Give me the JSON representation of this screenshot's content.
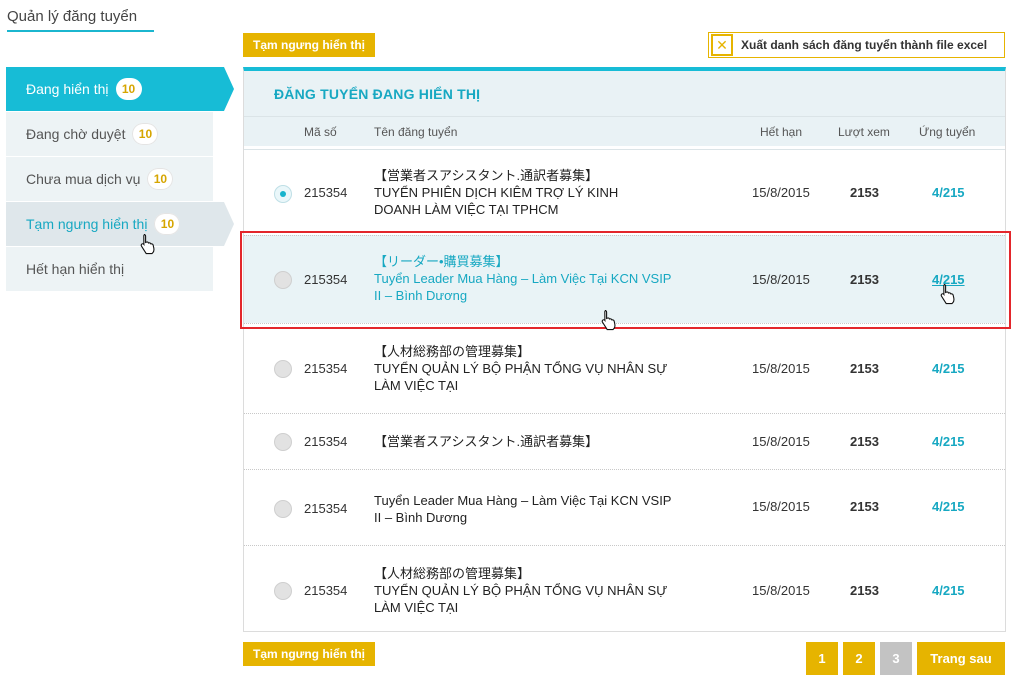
{
  "page": {
    "title": "Quản lý đăng tuyển"
  },
  "sidebar": {
    "items": [
      {
        "label": "Đang hiển thị",
        "count": "10"
      },
      {
        "label": "Đang chờ duyệt",
        "count": "10"
      },
      {
        "label": "Chưa mua dịch vụ",
        "count": "10"
      },
      {
        "label": "Tạm ngưng hiển thị",
        "count": "10"
      },
      {
        "label": "Hết hạn hiển thị"
      }
    ]
  },
  "toolbar": {
    "suspend_label": "Tạm ngưng hiển thị",
    "export_label": "Xuất danh sách đăng tuyển thành file excel",
    "export_icon": "excel-icon"
  },
  "panel": {
    "heading": "ĐĂNG TUYỂN ĐANG HIỂN THỊ",
    "columns": {
      "id": "Mã số",
      "title": "Tên đăng tuyển",
      "expiry": "Hết hạn",
      "views": "Lượt xem",
      "applied": "Ứng tuyển"
    },
    "rows": [
      {
        "id": "215354",
        "title_lines": [
          "【営業者スアシスタント.通訳者募集】",
          "TUYỂN PHIÊN DỊCH KIÊM TRỢ LÝ KINH",
          "DOANH LÀM VIỆC TẠI TPHCM"
        ],
        "expiry": "15/8/2015",
        "views": "2153",
        "applied": "4/215"
      },
      {
        "id": "215354",
        "title_lines": [
          "【リーダー•購買募集】",
          "Tuyển Leader Mua Hàng – Làm Việc Tại KCN VSIP",
          "II – Bình Dương"
        ],
        "expiry": "15/8/2015",
        "views": "2153",
        "applied": "4/215"
      },
      {
        "id": "215354",
        "title_lines": [
          "【人材総務部の管理募集】",
          "TUYỂN QUẢN LÝ BỘ PHẬN TỔNG VỤ NHÂN SỰ",
          "LÀM VIỆC TẠI"
        ],
        "expiry": "15/8/2015",
        "views": "2153",
        "applied": "4/215"
      },
      {
        "id": "215354",
        "title_lines": [
          "【営業者スアシスタント.通訳者募集】"
        ],
        "expiry": "15/8/2015",
        "views": "2153",
        "applied": "4/215"
      },
      {
        "id": "215354",
        "title_lines": [
          "Tuyển Leader Mua Hàng – Làm Việc Tại KCN VSIP",
          "II – Bình Dương"
        ],
        "expiry": "15/8/2015",
        "views": "2153",
        "applied": "4/215"
      },
      {
        "id": "215354",
        "title_lines": [
          "【人材総務部の管理募集】",
          "TUYỂN QUẢN LÝ BỘ PHẬN TỔNG VỤ NHÂN SỰ",
          "LÀM VIỆC TẠI"
        ],
        "expiry": "15/8/2015",
        "views": "2153",
        "applied": "4/215"
      }
    ]
  },
  "pagination": {
    "pages": [
      "1",
      "2",
      "3"
    ],
    "next_label": "Trang sau"
  },
  "colors": {
    "accent": "#17bcd6",
    "button": "#e6b400",
    "selection": "#e3262b"
  }
}
